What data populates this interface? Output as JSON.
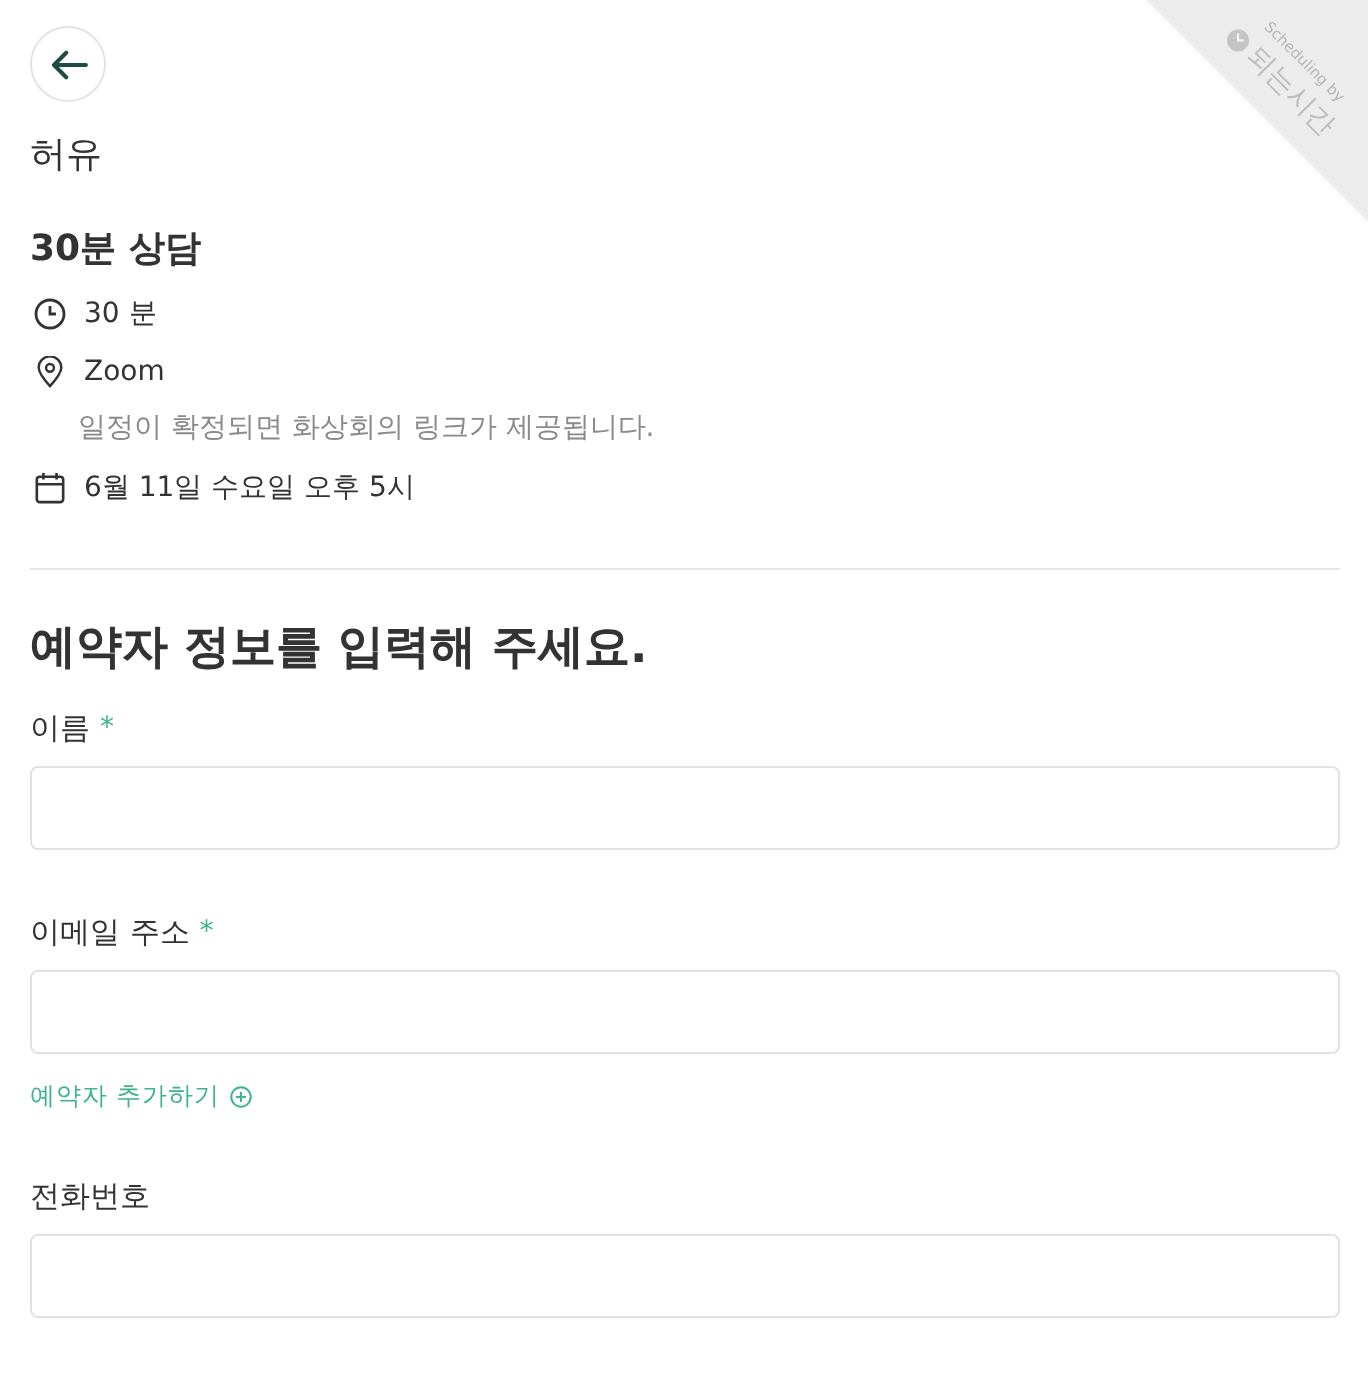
{
  "ribbon": {
    "caption": "Scheduling by",
    "brand": "되는시간"
  },
  "host": {
    "name": "허유"
  },
  "event": {
    "title": "30분 상담",
    "details": [
      {
        "kind": "duration",
        "text": "30 분"
      },
      {
        "kind": "location",
        "text": "Zoom",
        "note": "일정이 확정되면 화상회의 링크가 제공됩니다."
      },
      {
        "kind": "datetime",
        "text": "6월 11일 수요일 오후 5시"
      }
    ]
  },
  "form": {
    "title": "예약자 정보를 입력해 주세요.",
    "required_mark": "*",
    "fields": [
      {
        "label": "이름",
        "required": true
      },
      {
        "label": "이메일 주소",
        "required": true,
        "add_link": "예약자 추가하기"
      },
      {
        "label": "전화번호",
        "required": false
      }
    ]
  }
}
